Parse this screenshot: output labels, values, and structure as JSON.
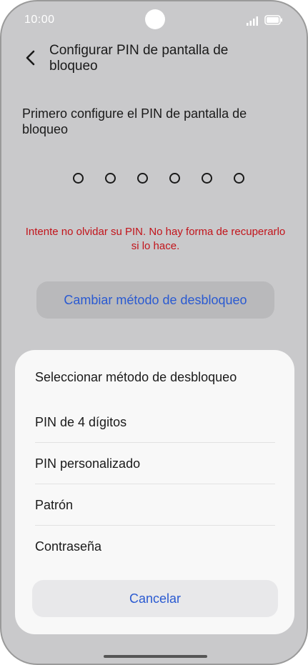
{
  "status_bar": {
    "time": "10:00"
  },
  "header": {
    "title": "Configurar PIN de pantalla de bloqueo",
    "back_icon": "chevron-left-icon"
  },
  "instruction": "Primero configure el PIN de pantalla de bloqueo",
  "pin": {
    "length": 6,
    "entered": 0
  },
  "warning": "Intente no olvidar su PIN. No hay forma de recuperarlo si lo hace.",
  "change_method_label": "Cambiar método de desbloqueo",
  "sheet": {
    "title": "Seleccionar método de desbloqueo",
    "options": [
      {
        "label": "PIN de 4 dígitos"
      },
      {
        "label": "PIN personalizado"
      },
      {
        "label": "Patrón"
      },
      {
        "label": "Contraseña"
      }
    ],
    "cancel_label": "Cancelar"
  },
  "colors": {
    "background": "#c9c9cb",
    "accent": "#2a5ad1",
    "warning": "#c2141b",
    "sheet": "#f8f8f8"
  }
}
